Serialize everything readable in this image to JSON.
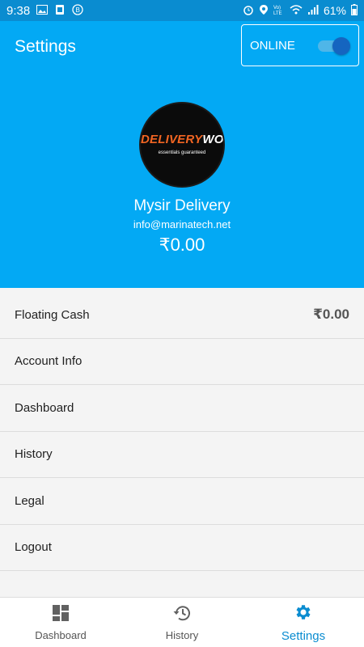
{
  "statusbar": {
    "time": "9:38",
    "battery": "61%",
    "icons_left": [
      "image-icon",
      "android-icon",
      "bbm-icon"
    ],
    "icons_right": [
      "alarm-icon",
      "location-icon",
      "volte-icon",
      "wifi-icon",
      "signal-icon",
      "battery-icon"
    ]
  },
  "appbar": {
    "title": "Settings",
    "status_label": "ONLINE",
    "online": true
  },
  "profile": {
    "logo_part1": "DELIVERY",
    "logo_part2": "WOAL",
    "logo_tagline": "essentials guaranteed",
    "name": "Mysir Delivery",
    "email": "info@marinatech.net",
    "balance": "₹0.00"
  },
  "menu": {
    "items": [
      {
        "label": "Floating Cash",
        "value": "₹0.00"
      },
      {
        "label": "Account Info"
      },
      {
        "label": "Dashboard"
      },
      {
        "label": "History"
      },
      {
        "label": "Legal"
      },
      {
        "label": "Logout"
      }
    ]
  },
  "bottom_nav": {
    "items": [
      {
        "label": "Dashboard",
        "icon": "dashboard-icon"
      },
      {
        "label": "History",
        "icon": "history-icon"
      },
      {
        "label": "Settings",
        "icon": "gear-icon",
        "active": true
      }
    ]
  },
  "colors": {
    "primary": "#03a9f4",
    "statusbar": "#0a8cd0",
    "active_nav": "#0a8cd0",
    "brand_orange": "#f26522"
  }
}
